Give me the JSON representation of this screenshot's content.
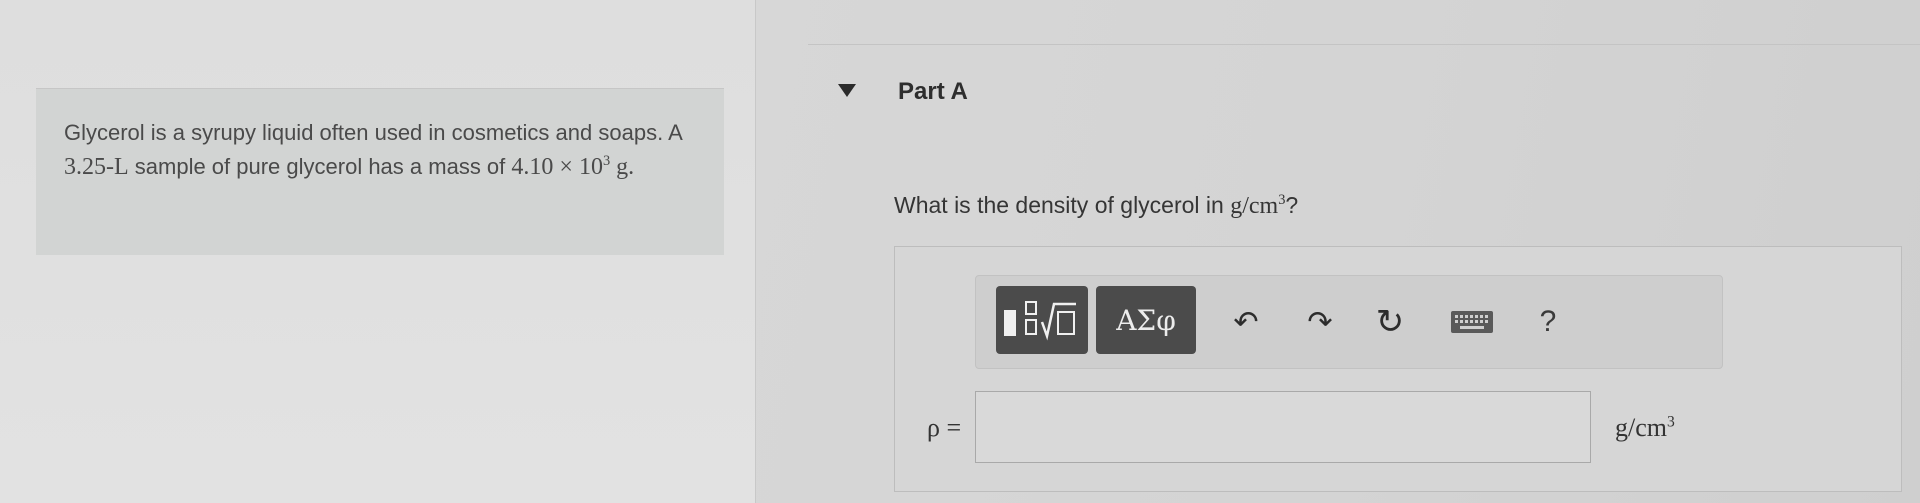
{
  "problem": {
    "text_part1": "Glycerol is a syrupy liquid often used in cosmetics and soaps. A ",
    "volume": "3.25-L",
    "text_part2": " sample of pure glycerol has a mass of ",
    "mass_coeff": "4.10",
    "times": "×",
    "mass_base": "10",
    "mass_exp": "3",
    "mass_unit": "g."
  },
  "part": {
    "title": "Part A",
    "question_prefix": "What is the density of glycerol in ",
    "question_unit": "g/cm",
    "question_unit_exp": "3",
    "question_suffix": "?"
  },
  "toolbar": {
    "symbols_label": "ΑΣφ",
    "undo_icon": "↶",
    "redo_icon": "↷",
    "reset_icon": "↻",
    "help_label": "?"
  },
  "answer": {
    "label": "ρ =",
    "value": "",
    "unit": "g/cm",
    "unit_exp": "3"
  }
}
